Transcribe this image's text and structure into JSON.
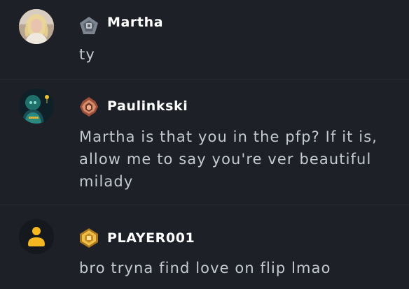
{
  "messages": [
    {
      "username": "Martha",
      "text": "ty",
      "avatar_icon": "woman-photo-avatar",
      "badge_icon": "pentagon-rank-badge",
      "badge_color": "#7d8590"
    },
    {
      "username": "Paulinkski",
      "text": "Martha is that you in the pfp? If it is, allow me to say you're ver beautiful milady",
      "avatar_icon": "hooded-figure-avatar",
      "badge_icon": "bronze-rank-badge",
      "badge_color": "#c9795a"
    },
    {
      "username": "PLAYER001",
      "text": "bro tryna find love on flip lmao",
      "avatar_icon": "default-user-avatar",
      "badge_icon": "gold-rank-badge",
      "badge_color": "#e3b13c"
    }
  ],
  "colors": {
    "background": "#1d2026",
    "username": "#ffffff",
    "message_text": "#c5c9d1",
    "default_avatar": "#f5b820"
  }
}
